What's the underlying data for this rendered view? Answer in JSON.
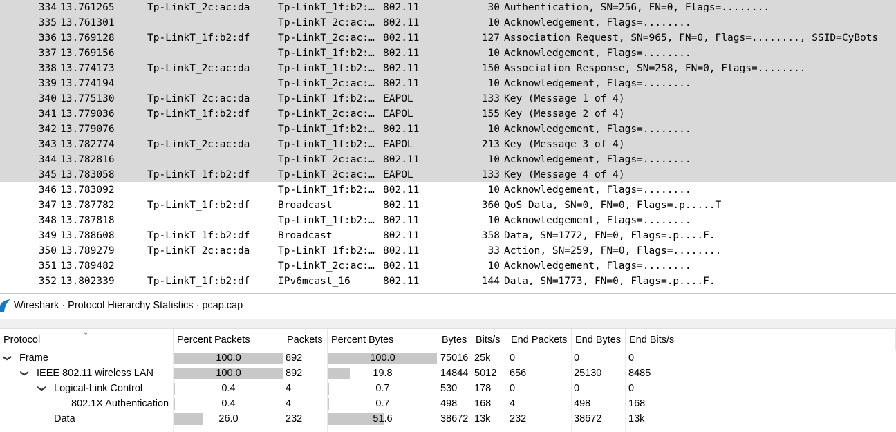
{
  "packets": [
    {
      "no": "334",
      "time": "13.761265",
      "src": "Tp-LinkT_2c:ac:da",
      "dst": "Tp-LinkT_1f:b2:…",
      "proto": "802.11",
      "len": "30",
      "info": "Authentication, SN=256, FN=0, Flags=........",
      "selected": true
    },
    {
      "no": "335",
      "time": "13.761301",
      "src": "",
      "dst": "Tp-LinkT_2c:ac:…",
      "proto": "802.11",
      "len": "10",
      "info": "Acknowledgement, Flags=........",
      "selected": true
    },
    {
      "no": "336",
      "time": "13.769128",
      "src": "Tp-LinkT_1f:b2:df",
      "dst": "Tp-LinkT_2c:ac:…",
      "proto": "802.11",
      "len": "127",
      "info": "Association Request, SN=965, FN=0, Flags=........, SSID=CyBots",
      "selected": true
    },
    {
      "no": "337",
      "time": "13.769156",
      "src": "",
      "dst": "Tp-LinkT_1f:b2:…",
      "proto": "802.11",
      "len": "10",
      "info": "Acknowledgement, Flags=........",
      "selected": true
    },
    {
      "no": "338",
      "time": "13.774173",
      "src": "Tp-LinkT_2c:ac:da",
      "dst": "Tp-LinkT_1f:b2:…",
      "proto": "802.11",
      "len": "150",
      "info": "Association Response, SN=258, FN=0, Flags=........",
      "selected": true
    },
    {
      "no": "339",
      "time": "13.774194",
      "src": "",
      "dst": "Tp-LinkT_2c:ac:…",
      "proto": "802.11",
      "len": "10",
      "info": "Acknowledgement, Flags=........",
      "selected": true
    },
    {
      "no": "340",
      "time": "13.775130",
      "src": "Tp-LinkT_2c:ac:da",
      "dst": "Tp-LinkT_1f:b2:…",
      "proto": "EAPOL",
      "len": "133",
      "info": "Key (Message 1 of 4)",
      "selected": true
    },
    {
      "no": "341",
      "time": "13.779036",
      "src": "Tp-LinkT_1f:b2:df",
      "dst": "Tp-LinkT_2c:ac:…",
      "proto": "EAPOL",
      "len": "155",
      "info": "Key (Message 2 of 4)",
      "selected": true
    },
    {
      "no": "342",
      "time": "13.779076",
      "src": "",
      "dst": "Tp-LinkT_1f:b2:…",
      "proto": "802.11",
      "len": "10",
      "info": "Acknowledgement, Flags=........",
      "selected": true
    },
    {
      "no": "343",
      "time": "13.782774",
      "src": "Tp-LinkT_2c:ac:da",
      "dst": "Tp-LinkT_1f:b2:…",
      "proto": "EAPOL",
      "len": "213",
      "info": "Key (Message 3 of 4)",
      "selected": true
    },
    {
      "no": "344",
      "time": "13.782816",
      "src": "",
      "dst": "Tp-LinkT_2c:ac:…",
      "proto": "802.11",
      "len": "10",
      "info": "Acknowledgement, Flags=........",
      "selected": true
    },
    {
      "no": "345",
      "time": "13.783058",
      "src": "Tp-LinkT_1f:b2:df",
      "dst": "Tp-LinkT_2c:ac:…",
      "proto": "EAPOL",
      "len": "133",
      "info": "Key (Message 4 of 4)",
      "selected": true
    },
    {
      "no": "346",
      "time": "13.783092",
      "src": "",
      "dst": "Tp-LinkT_1f:b2:…",
      "proto": "802.11",
      "len": "10",
      "info": "Acknowledgement, Flags=........",
      "selected": false
    },
    {
      "no": "347",
      "time": "13.787782",
      "src": "Tp-LinkT_1f:b2:df",
      "dst": "Broadcast",
      "proto": "802.11",
      "len": "360",
      "info": "QoS Data, SN=0, FN=0, Flags=.p.....T",
      "selected": false
    },
    {
      "no": "348",
      "time": "13.787818",
      "src": "",
      "dst": "Tp-LinkT_1f:b2:…",
      "proto": "802.11",
      "len": "10",
      "info": "Acknowledgement, Flags=........",
      "selected": false
    },
    {
      "no": "349",
      "time": "13.788608",
      "src": "Tp-LinkT_1f:b2:df",
      "dst": "Broadcast",
      "proto": "802.11",
      "len": "358",
      "info": "Data, SN=1772, FN=0, Flags=.p....F.",
      "selected": false
    },
    {
      "no": "350",
      "time": "13.789279",
      "src": "Tp-LinkT_2c:ac:da",
      "dst": "Tp-LinkT_1f:b2:…",
      "proto": "802.11",
      "len": "33",
      "info": "Action, SN=259, FN=0, Flags=........",
      "selected": false
    },
    {
      "no": "351",
      "time": "13.789482",
      "src": "",
      "dst": "Tp-LinkT_2c:ac:…",
      "proto": "802.11",
      "len": "10",
      "info": "Acknowledgement, Flags=........",
      "selected": false
    },
    {
      "no": "352",
      "time": "13.802339",
      "src": "Tp-LinkT_1f:b2:df",
      "dst": "IPv6mcast_16",
      "proto": "802.11",
      "len": "144",
      "info": "Data, SN=1773, FN=0, Flags=.p....F.",
      "selected": false
    }
  ],
  "stats_window": {
    "title": "Wireshark · Protocol Hierarchy Statistics · pcap.cap",
    "icon": "wireshark-fin-icon",
    "bar_color": "#c8c8c8",
    "columns": [
      "Protocol",
      "Percent Packets",
      "Packets",
      "Percent Bytes",
      "Bytes",
      "Bits/s",
      "End Packets",
      "End Bytes",
      "End Bits/s"
    ],
    "rows": [
      {
        "protocol": "Frame",
        "expander": "expanded",
        "pct_packets": "100.0",
        "pct_packets_value": 100.0,
        "packets": "892",
        "pct_bytes": "100.0",
        "pct_bytes_value": 100.0,
        "bytes": "75016",
        "bits_s": "25k",
        "end_packets": "0",
        "end_bytes": "0",
        "end_bits_s": "0"
      },
      {
        "protocol": "IEEE 802.11 wireless LAN",
        "expander": "expanded",
        "pct_packets": "100.0",
        "pct_packets_value": 100.0,
        "packets": "892",
        "pct_bytes": "19.8",
        "pct_bytes_value": 19.8,
        "bytes": "14844",
        "bits_s": "5012",
        "end_packets": "656",
        "end_bytes": "25130",
        "end_bits_s": "8485"
      },
      {
        "protocol": "Logical-Link Control",
        "expander": "expanded",
        "pct_packets": "0.4",
        "pct_packets_value": 0.4,
        "packets": "4",
        "pct_bytes": "0.7",
        "pct_bytes_value": 0.7,
        "bytes": "530",
        "bits_s": "178",
        "end_packets": "0",
        "end_bytes": "0",
        "end_bits_s": "0"
      },
      {
        "protocol": "802.1X Authentication",
        "expander": "none",
        "pct_packets": "0.4",
        "pct_packets_value": 0.4,
        "packets": "4",
        "pct_bytes": "0.7",
        "pct_bytes_value": 0.7,
        "bytes": "498",
        "bits_s": "168",
        "end_packets": "4",
        "end_bytes": "498",
        "end_bits_s": "168"
      },
      {
        "protocol": "Data",
        "expander": "none",
        "pct_packets": "26.0",
        "pct_packets_value": 26.0,
        "packets": "232",
        "pct_bytes": "51.6",
        "pct_bytes_value": 51.6,
        "bytes": "38672",
        "bits_s": "13k",
        "end_packets": "232",
        "end_bytes": "38672",
        "end_bits_s": "13k"
      }
    ]
  }
}
